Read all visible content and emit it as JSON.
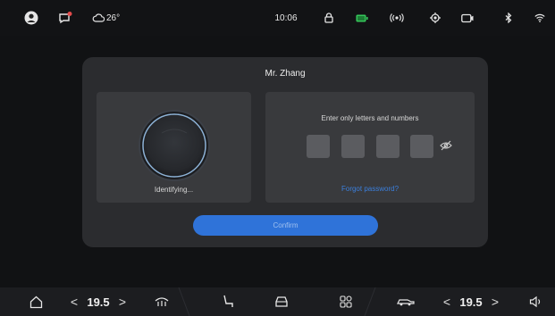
{
  "status_bar": {
    "weather": "26°",
    "time": "10:06",
    "icons": [
      "avatar-icon",
      "chat-icon",
      "cloud-icon",
      "lock-icon",
      "battery-icon",
      "wireless-icon",
      "location-icon",
      "camera-icon",
      "bluetooth-icon",
      "wifi-icon"
    ]
  },
  "dialog": {
    "username": "Mr. Zhang",
    "face_status": "Identifying...",
    "password_prompt": "Enter only letters and numbers",
    "forgot_password": "Forgot password?",
    "confirm_label": "Confirm"
  },
  "bottom_bar": {
    "left_temp": "19.5",
    "right_temp": "19.5",
    "prev": "<",
    "next": ">",
    "icons": [
      "home-icon",
      "defrost-icon",
      "seat-icon",
      "car-icon",
      "apps-grid-icon",
      "car-side-icon",
      "volume-icon"
    ]
  },
  "colors": {
    "accent": "#2f73d9",
    "link": "#3b7fdc",
    "dialog_bg": "#2b2c2f",
    "panel_bg": "#393a3d",
    "battery": "#35c75a",
    "notification": "#e24b4b"
  }
}
